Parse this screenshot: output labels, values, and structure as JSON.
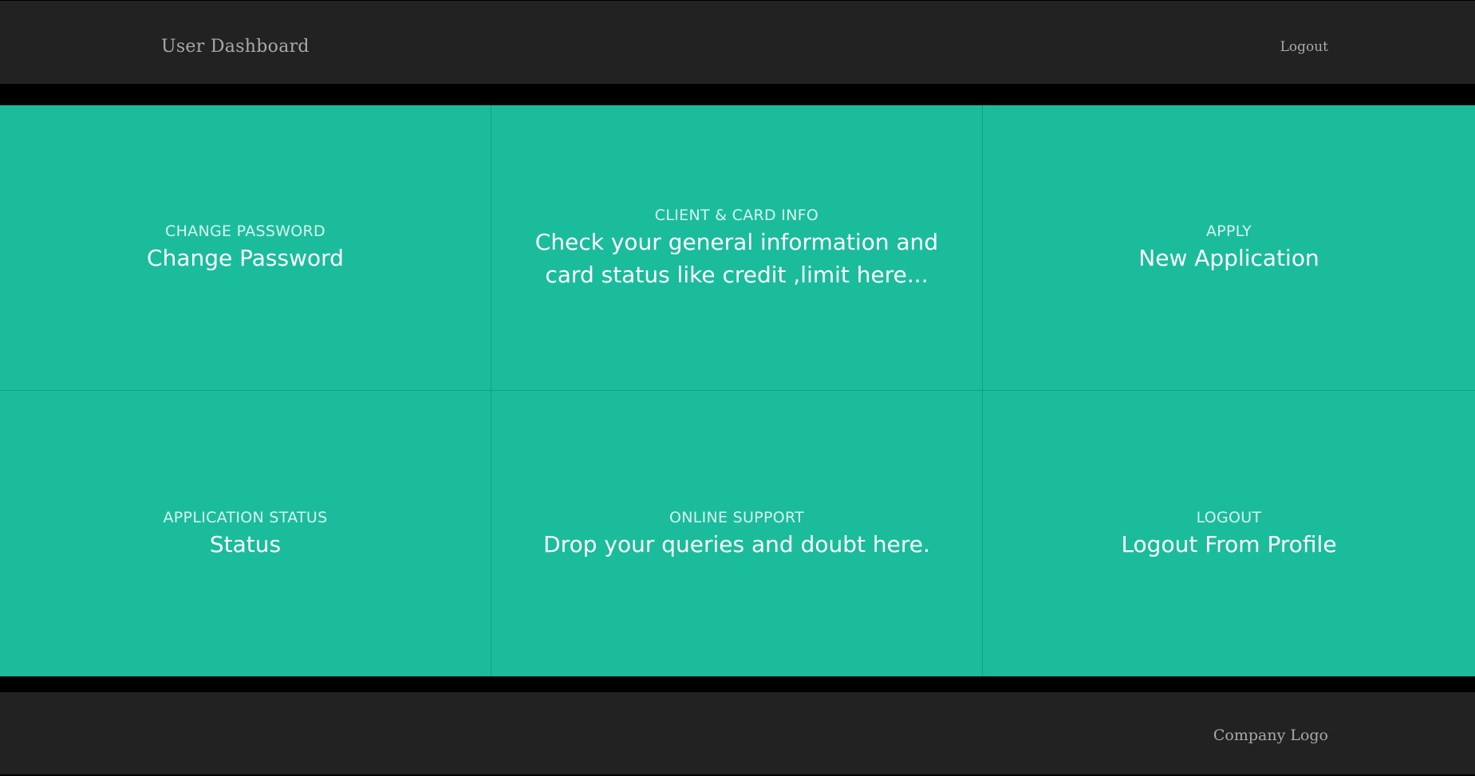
{
  "header": {
    "brand": "User Dashboard",
    "logout_label": "Logout"
  },
  "tiles": [
    {
      "label": "CHANGE PASSWORD",
      "description": "Change Password"
    },
    {
      "label": "CLIENT & CARD INFO",
      "description": "Check your general information and card status like credit ,limit here..."
    },
    {
      "label": "APPLY",
      "description": "New Application"
    },
    {
      "label": "APPLICATION STATUS",
      "description": "Status"
    },
    {
      "label": "ONLINE SUPPORT",
      "description": "Drop your queries and doubt here."
    },
    {
      "label": "LOGOUT",
      "description": "Logout From Profile"
    }
  ],
  "footer": {
    "company_logo": "Company Logo"
  },
  "colors": {
    "header_bg": "#222222",
    "tile_bg": "#1abc9c",
    "page_bg": "#000000",
    "nav_text": "#a9a9a9"
  }
}
